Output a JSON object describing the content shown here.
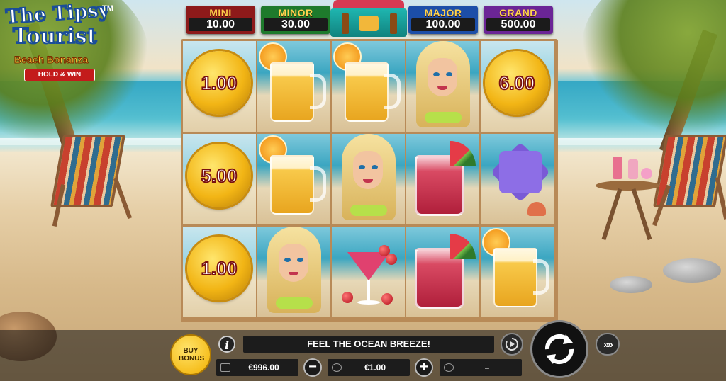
{
  "game": {
    "logo": {
      "line1": "The Tipsy",
      "line2": "Tourist",
      "trademark": "TM",
      "subtitle": "Beach Bonanza",
      "badge": "HOLD & WIN"
    },
    "jackpots": [
      {
        "label": "MINI",
        "value": "10.00",
        "color": "#8d1a1a"
      },
      {
        "label": "MINOR",
        "value": "30.00",
        "color": "#1e7a2c"
      },
      {
        "label": "MAJOR",
        "value": "100.00",
        "color": "#1c4ea8"
      },
      {
        "label": "GRAND",
        "value": "500.00",
        "color": "#6b2596"
      }
    ],
    "reels": {
      "columns": 5,
      "rows": 3,
      "grid": [
        [
          {
            "symbol": "coin",
            "value": "1.00"
          },
          {
            "symbol": "beer-mug"
          },
          {
            "symbol": "beer-mug"
          },
          {
            "symbol": "tourist-girl"
          },
          {
            "symbol": "coin",
            "value": "6.00"
          }
        ],
        [
          {
            "symbol": "coin",
            "value": "5.00"
          },
          {
            "symbol": "beer-mug"
          },
          {
            "symbol": "tourist-girl"
          },
          {
            "symbol": "watermelon-drink"
          },
          {
            "symbol": "starfish"
          }
        ],
        [
          {
            "symbol": "coin",
            "value": "1.00"
          },
          {
            "symbol": "tourist-girl"
          },
          {
            "symbol": "cherry-cocktail"
          },
          {
            "symbol": "watermelon-drink"
          },
          {
            "symbol": "beer-mug"
          }
        ]
      ]
    },
    "controls": {
      "buy_bonus": "BUY BONUS",
      "info": "i",
      "message": "FEEL THE OCEAN BREEZE!",
      "balance": "€996.00",
      "bet": "€1.00",
      "win": "–",
      "minus": "−",
      "plus": "+",
      "autoplay_icon": "play-circle-icon",
      "spin_icon": "spin-arrows-icon",
      "turbo_icon": "fast-forward-icon",
      "turbo_glyph": "»»"
    }
  }
}
